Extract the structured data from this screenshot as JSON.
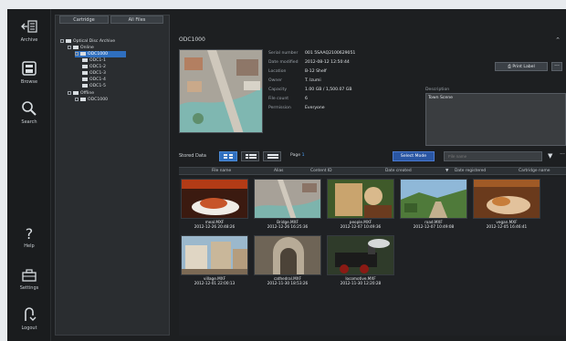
{
  "nav": {
    "archive": "Archive",
    "browse": "Browse",
    "search": "Search",
    "help": "Help",
    "settings": "Settings",
    "logout": "Logout"
  },
  "tabs": {
    "cartridge": "Cartridge",
    "all_files": "All Files"
  },
  "tree": {
    "root": "Optical Disc Archive",
    "online": "Online",
    "selected": "ODC1000",
    "children": [
      "ODC1-1",
      "ODC1-2",
      "ODC1-3",
      "ODC1-4",
      "ODC1-5"
    ],
    "offline": "Offline",
    "offline_child": "ODC1000"
  },
  "details": {
    "title": "ODC1000",
    "fields": [
      {
        "key": "Serial number",
        "value": "001 5SAAQ2100629051"
      },
      {
        "key": "Date modified",
        "value": "2012-08-12 12:50:44"
      },
      {
        "key": "Location",
        "value": "B-12 Shelf"
      },
      {
        "key": "Owner",
        "value": "T. Izumi"
      },
      {
        "key": "Capacity",
        "value": "1.00 GB / 1,500.07 GB"
      },
      {
        "key": "File count",
        "value": "6"
      },
      {
        "key": "Permission",
        "value": "Everyone"
      }
    ],
    "print_label": "Print Label",
    "more": "···",
    "description_label": "Description",
    "description_value": "Town Scene"
  },
  "toolbar": {
    "stored_data": "Stored Data",
    "page_label": "Page",
    "page_number": "1",
    "select_mode": "Select Mode",
    "filter_placeholder": "File name",
    "more": "···"
  },
  "columns": [
    "File name",
    "Alias",
    "Content ID",
    "Date created",
    "Date registered",
    "Cartridge name"
  ],
  "files": [
    {
      "name": "meal.MXF",
      "date": "2012-12-26 20:48:26",
      "scene": "meal"
    },
    {
      "name": "Bridge.MXF",
      "date": "2012-12-26 16:25:36",
      "scene": "bridge"
    },
    {
      "name": "people.MXF",
      "date": "2012-12-07 10:49:36",
      "scene": "people"
    },
    {
      "name": "road.MXF",
      "date": "2012-12-07 10:49:08",
      "scene": "road"
    },
    {
      "name": "vegan.MXF",
      "date": "2012-12-05 16:46:41",
      "scene": "vegan"
    },
    {
      "name": "village.MXF",
      "date": "2012-12-01 22:00:13",
      "scene": "village"
    },
    {
      "name": "cathedral.MXF",
      "date": "2012-11-30 18:53:26",
      "scene": "cathedral"
    },
    {
      "name": "locomotive.MXF",
      "date": "2012-11-30 12:20:28",
      "scene": "locomotive"
    }
  ],
  "colors": {
    "accent": "#2f6fbf",
    "select_mode": "#2a56a3",
    "page_number": "#4aa3ff"
  }
}
